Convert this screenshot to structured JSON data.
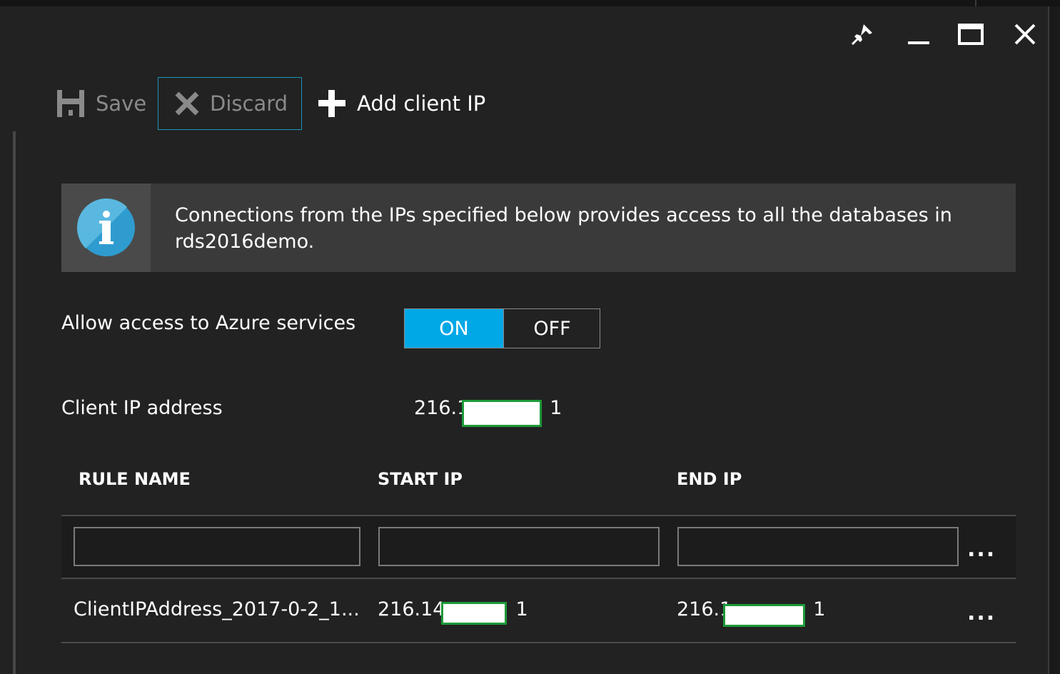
{
  "window": {
    "controls": [
      "pin-icon",
      "minimize-icon",
      "maximize-icon",
      "close-icon"
    ]
  },
  "toolbar": {
    "save_label": "Save",
    "discard_label": "Discard",
    "add_client_ip_label": "Add client IP"
  },
  "info": {
    "icon": "info-icon",
    "message": "Connections from the IPs specified below provides access to all the databases in rds2016demo."
  },
  "azure_access": {
    "label": "Allow access to Azure services",
    "on_label": "ON",
    "off_label": "OFF",
    "selected": "ON"
  },
  "client_ip": {
    "label": "Client IP address",
    "value_prefix": "216.1",
    "value_suffix": "1"
  },
  "table": {
    "columns": [
      "RULE NAME",
      "START IP",
      "END IP"
    ],
    "new_row": {
      "rule_name": "",
      "start_ip": "",
      "end_ip": ""
    },
    "rows": [
      {
        "rule_name": "ClientIPAddress_2017-0-2_1...",
        "start_ip_prefix": "216.14",
        "start_ip_suffix": "1",
        "end_ip_prefix": "216.1",
        "end_ip_suffix": "1"
      }
    ],
    "more_label": "..."
  },
  "colors": {
    "accent": "#00a8e6",
    "focus_border": "#1b94b8",
    "redaction_border": "#1e9a3a",
    "background": "#222222"
  }
}
